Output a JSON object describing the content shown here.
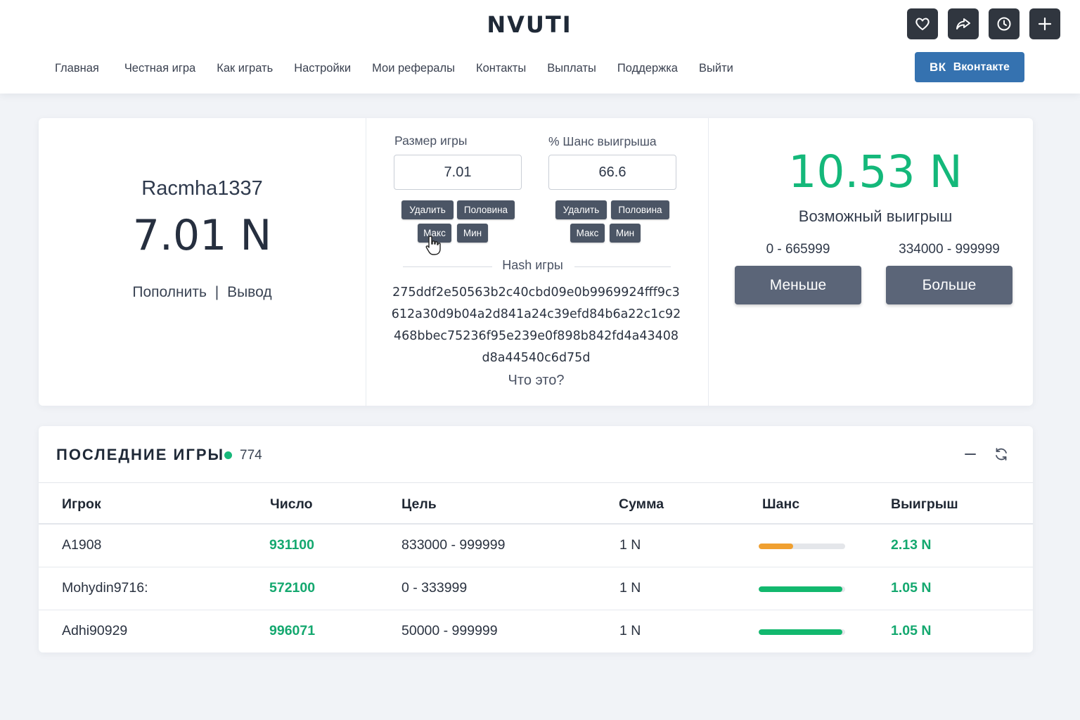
{
  "header": {
    "brand": "NVUTI",
    "nav": [
      "Главная",
      "Честная игра",
      "Как играть",
      "Настройки",
      "Мои рефералы",
      "Контакты",
      "Выплаты",
      "Поддержка",
      "Выйти"
    ],
    "vk": {
      "logo": "ВК",
      "label": "Вконтакте"
    },
    "icons": [
      "heart-icon",
      "share-icon",
      "history-clock-icon",
      "plus-icon"
    ]
  },
  "account": {
    "username": "Racmha1337",
    "balance": "7.01 N",
    "deposit": "Пополнить",
    "separator": "|",
    "withdraw": "Вывод"
  },
  "bet": {
    "size_label": "Размер игры",
    "size_value": "7.01",
    "chance_label": "% Шанс выигрыша",
    "chance_value": "66.6",
    "btn_clear": "Удалить",
    "btn_half": "Половина",
    "btn_max": "Макс",
    "btn_min": "Мин",
    "hash_title": "Hash игры",
    "hash": "275ddf2e50563b2c40cbd09e0b9969924fff9c3612a30d9b04a2d841a24c39efd84b6a22c1c92468bbec75236f95e239e0f898b842fd4a43408d8a44540c6d75d",
    "what_is": "Что это?"
  },
  "win": {
    "amount": "10.53 N",
    "label": "Возможный выигрыш",
    "range_low": "0 - 665999",
    "range_high": "334000 - 999999",
    "btn_less": "Меньше",
    "btn_more": "Больше"
  },
  "games": {
    "title": "ПОСЛЕДНИЕ ИГРЫ",
    "online": "774",
    "columns": [
      "Игрок",
      "Число",
      "Цель",
      "Сумма",
      "Шанс",
      "Выигрыш"
    ],
    "rows": [
      {
        "player": "A1908",
        "number": "931100",
        "target": "833000 - 999999",
        "sum": "1 N",
        "chance": 0.4,
        "chance_color": "#f0a030",
        "win": "2.13 N"
      },
      {
        "player": "Mohydin9716:",
        "number": "572100",
        "target": "0 - 333999",
        "sum": "1 N",
        "chance": 0.97,
        "chance_color": "#12b86e",
        "win": "1.05 N"
      },
      {
        "player": "Adhi90929",
        "number": "996071",
        "target": "50000 - 999999",
        "sum": "1 N",
        "chance": 0.97,
        "chance_color": "#12b86e",
        "win": "1.05 N"
      }
    ]
  },
  "colors": {
    "accent_green": "#14b87a",
    "vk_blue": "#3572b0",
    "dark_button": "#5b6578"
  }
}
